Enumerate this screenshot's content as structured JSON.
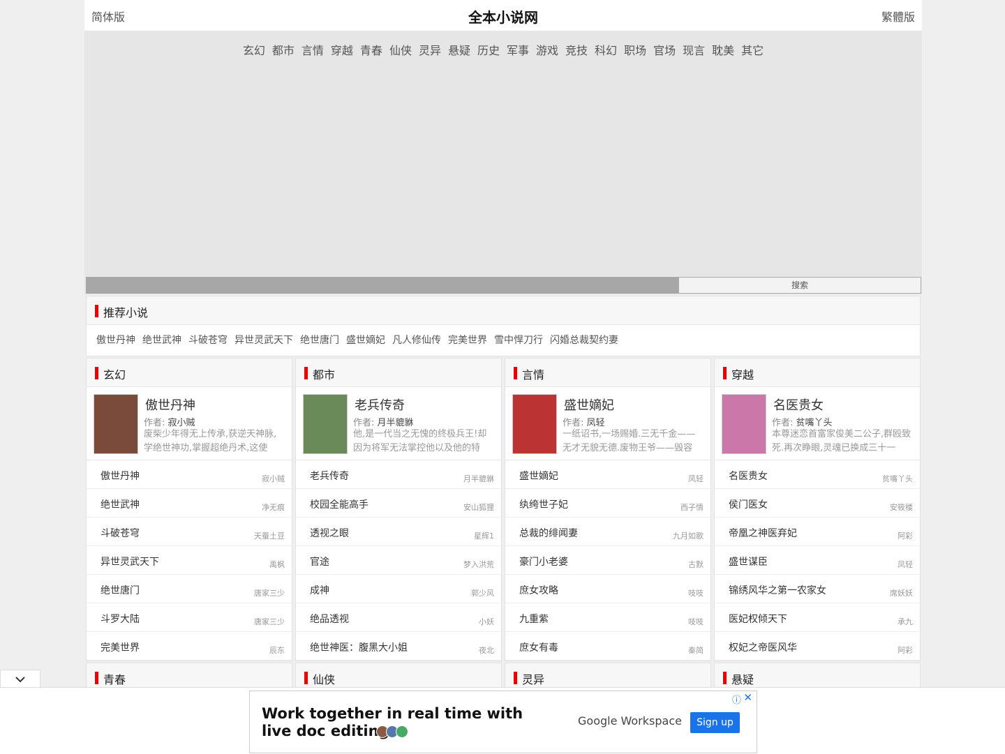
{
  "header": {
    "left": "简体版",
    "site_title": "全本小说网",
    "right": "繁體版"
  },
  "nav": [
    "玄幻",
    "都市",
    "言情",
    "穿越",
    "青春",
    "仙侠",
    "灵异",
    "悬疑",
    "历史",
    "军事",
    "游戏",
    "竞技",
    "科幻",
    "职场",
    "官场",
    "现言",
    "耽美",
    "其它"
  ],
  "search": {
    "button_label": "搜索"
  },
  "recommend": {
    "title": "推荐小说",
    "items": [
      "傲世丹神",
      "绝世武神",
      "斗破苍穹",
      "异世灵武天下",
      "绝世唐门",
      "盛世嫡妃",
      "凡人修仙传",
      "完美世界",
      "雪中悍刀行",
      "闪婚总裁契约妻"
    ]
  },
  "sections": [
    {
      "name": "玄幻",
      "featured": {
        "title": "傲世丹神",
        "author_label": "作者: ",
        "author": "寂小贼",
        "desc": "废柴少年得无上传承,获逆天神脉,学绝世神功,掌握超绝丹术,这使他..."
      },
      "rows": [
        [
          "傲世丹神",
          "寂小贼"
        ],
        [
          "绝世武神",
          "净无痕"
        ],
        [
          "斗破苍穹",
          "天蚕土豆"
        ],
        [
          "异世灵武天下",
          "禹枫"
        ],
        [
          "绝世唐门",
          "唐家三少"
        ],
        [
          "斗罗大陆",
          "唐家三少"
        ],
        [
          "完美世界",
          "辰东"
        ]
      ]
    },
    {
      "name": "都市",
      "featured": {
        "title": "老兵传奇",
        "author_label": "作者: ",
        "author": "月半貔貅",
        "desc": "他,是一代当之无愧的终极兵王!却因为将军无法掌控他以及他的特战..."
      },
      "rows": [
        [
          "老兵传奇",
          "月半貔貅"
        ],
        [
          "校园全能高手",
          "安山狐狸"
        ],
        [
          "透视之眼",
          "星辉1"
        ],
        [
          "官途",
          "梦入洪荒"
        ],
        [
          "成神",
          "郭少风"
        ],
        [
          "绝品透视",
          "小妖"
        ],
        [
          "绝世神医：腹黑大小姐",
          "夜北"
        ]
      ]
    },
    {
      "name": "言情",
      "featured": {
        "title": "盛世嫡妃",
        "author_label": "作者: ",
        "author": "凤轻",
        "desc": "一纸诏书,一场赐婚.三无千金——无才无貌无德.废物王爷——毁容残..."
      },
      "rows": [
        [
          "盛世嫡妃",
          "凤轻"
        ],
        [
          "纨绔世子妃",
          "西子情"
        ],
        [
          "总裁的绯闻妻",
          "九月如歌"
        ],
        [
          "豪门小老婆",
          "古默"
        ],
        [
          "庶女攻略",
          "吱吱"
        ],
        [
          "九重紫",
          "吱吱"
        ],
        [
          "庶女有毒",
          "秦简"
        ]
      ]
    },
    {
      "name": "穿越",
      "featured": {
        "title": "名医贵女",
        "author_label": "作者: ",
        "author": "贫嘴丫头",
        "desc": "本尊迷恋首富家俊美二公子,群殴致死.再次睁眼,灵魂已换成三十一岁..."
      },
      "rows": [
        [
          "名医贵女",
          "贫嘴丫头"
        ],
        [
          "侯门医女",
          "安筱楼"
        ],
        [
          "帝凰之神医弃妃",
          "阿彩"
        ],
        [
          "盛世谋臣",
          "凤轻"
        ],
        [
          "锦绣风华之第一农家女",
          "席妖妖"
        ],
        [
          "医妃权倾天下",
          "承九"
        ],
        [
          "权妃之帝医风华",
          "阿彩"
        ]
      ]
    }
  ],
  "sections2": [
    "青春",
    "仙侠",
    "灵异",
    "悬疑"
  ],
  "ad": {
    "line1": "Work together in real time with",
    "line2": "live doc editing.",
    "brand": "Google Workspace",
    "button": "Sign up",
    "colors": {
      "button": "#1a73e8"
    }
  }
}
